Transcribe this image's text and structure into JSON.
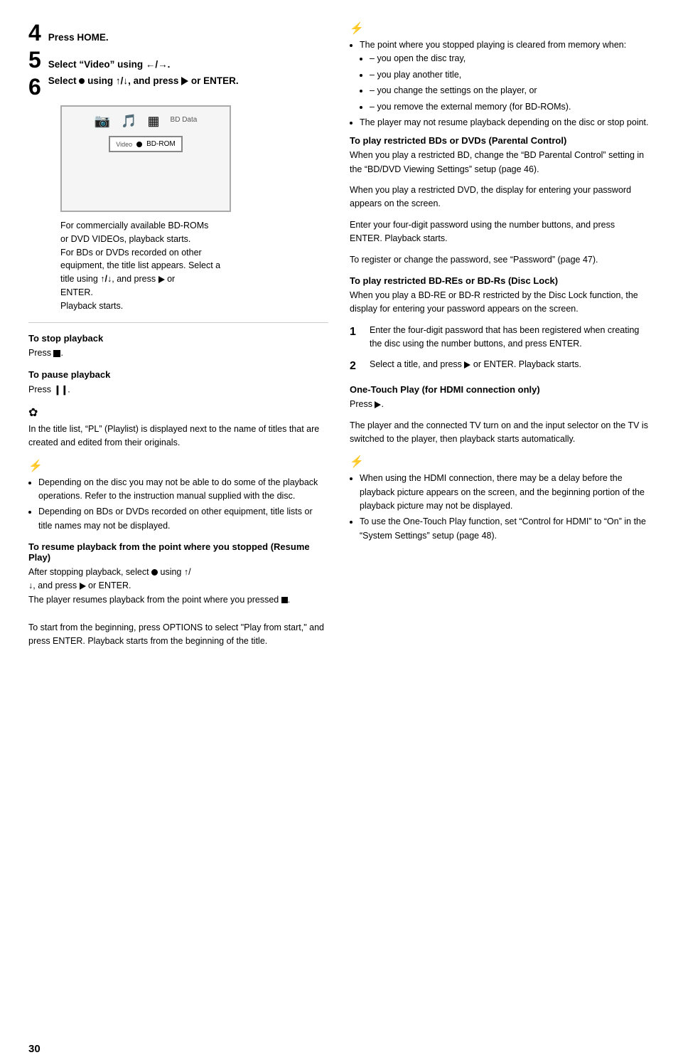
{
  "page": {
    "number": "30"
  },
  "left": {
    "step4": {
      "num": "4",
      "text": "Press HOME."
    },
    "step5": {
      "num": "5",
      "text": "Select “Video” using ←/→."
    },
    "step6": {
      "num": "6",
      "text": "Select",
      "text2": "using",
      "text3": ", and press",
      "text4": "or ENTER."
    },
    "screen": {
      "bd_data_label": "BD Data",
      "video_label": "Video",
      "bd_rom_label": "BD-ROM"
    },
    "caption": "For commercially available BD-ROMs\nor DVD VIDEOs, playback starts.\nFor BDs or DVDs recorded on other\nequipment, the title list appears. Select a\ntitle using ↑/↓, and press ► or\nENTER.\nPlayback starts.",
    "stop_section": {
      "heading": "To stop playback",
      "body": "Press ■."
    },
    "pause_section": {
      "heading": "To pause playback",
      "body": "Press ⏸."
    },
    "playlist_note": {
      "body": "In the title list, “PL” (Playlist) is displayed next to the name of titles that are created and edited from their originals."
    },
    "caution_bullets": [
      "Depending on the disc you may not be able to do some of the playback operations. Refer to the instruction manual supplied with the disc.",
      "Depending on BDs or DVDs recorded on other equipment, title lists or title names may not be displayed."
    ],
    "resume_section": {
      "heading": "To resume playback from the point where you stopped (Resume Play)",
      "body1": "After stopping playback, select",
      "body2": "using ↑/↓, and press ► or ENTER.",
      "body3": "The player resumes playback from the point where you pressed ■.",
      "body4": "To start from the beginning, press OPTIONS to select “Play from start,” and press ENTER. Playback starts from the beginning of the title."
    }
  },
  "right": {
    "caution_icon": "⚡",
    "caution_bullets": [
      "The point where you stopped playing is cleared from memory when:",
      "you open the disc tray,",
      "you play another title,",
      "you change the settings on the player, or",
      "you remove the external memory (for BD-ROMs).",
      "The player may not resume playback depending on the disc or stop point."
    ],
    "parental_section": {
      "heading": "To play restricted BDs or DVDs (Parental Control)",
      "body1": "When you play a restricted BD, change the “BD Parental Control” setting in the “BD/DVD Viewing Settings” setup (page 46).",
      "body2": "When you play a restricted DVD, the display for entering your password appears on the screen.",
      "body3": "Enter your four-digit password using the number buttons, and press ENTER. Playback starts.",
      "body4": "To register or change the password, see “Password” (page 47)."
    },
    "disc_lock_section": {
      "heading": "To play restricted BD-REs or BD-Rs (Disc Lock)",
      "intro": "When you play a BD-RE or BD-R restricted by the Disc Lock function, the display for entering your password appears on the screen.",
      "step1": {
        "num": "1",
        "text": "Enter the four-digit password that has been registered when creating the disc using the number buttons, and press ENTER."
      },
      "step2": {
        "num": "2",
        "text": "Select a title, and press ► or ENTER. Playback starts."
      }
    },
    "one_touch_section": {
      "heading": "One-Touch Play (for HDMI connection only)",
      "body1": "Press ►.",
      "body2": "The player and the connected TV turn on and the input selector on the TV is switched to the player, then playback starts automatically."
    },
    "hdmi_caution": [
      "When using the HDMI connection, there may be a delay before the playback picture appears on the screen, and the beginning portion of the playback picture may not be displayed.",
      "To use the One-Touch Play function, set “Control for HDMI” to “On” in the “System Settings” setup (page 48)."
    ]
  }
}
